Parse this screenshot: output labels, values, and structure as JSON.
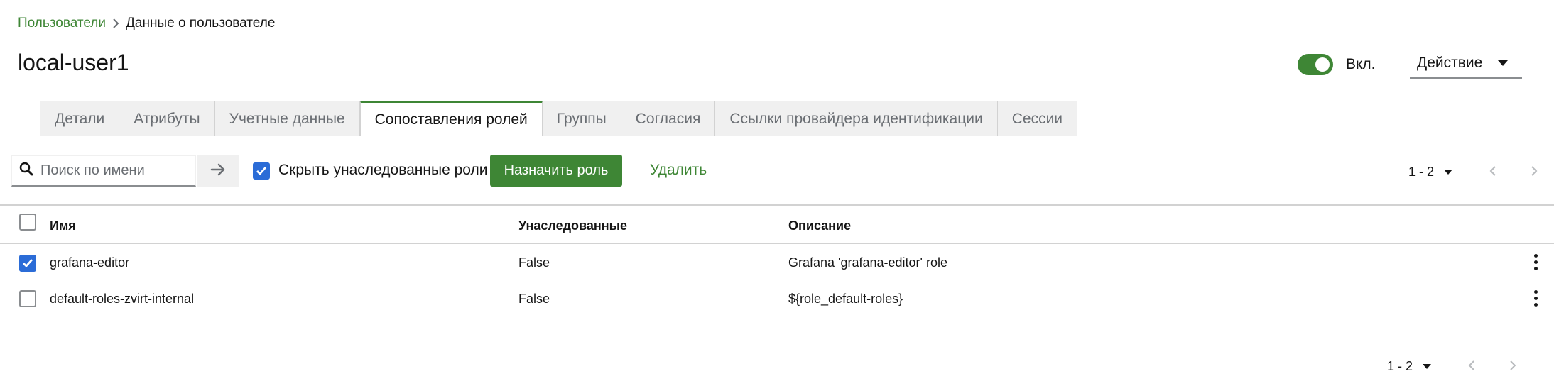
{
  "breadcrumb": {
    "parent": "Пользователи",
    "current": "Данные о пользователе"
  },
  "page_title": "local-user1",
  "enabled_toggle": {
    "label": "Вкл.",
    "on": true
  },
  "action_dropdown": {
    "label": "Действие"
  },
  "tabs": [
    {
      "label": "Детали",
      "active": false
    },
    {
      "label": "Атрибуты",
      "active": false
    },
    {
      "label": "Учетные данные",
      "active": false
    },
    {
      "label": "Сопоставления ролей",
      "active": true
    },
    {
      "label": "Группы",
      "active": false
    },
    {
      "label": "Согласия",
      "active": false
    },
    {
      "label": "Ссылки провайдера идентификации",
      "active": false
    },
    {
      "label": "Сессии",
      "active": false
    }
  ],
  "toolbar": {
    "search_placeholder": "Поиск по имени",
    "hide_inherited_label": "Скрыть унаследованные роли",
    "hide_inherited_checked": true,
    "assign_label": "Назначить роль",
    "delete_label": "Удалить",
    "pagination": "1 - 2"
  },
  "table": {
    "columns": [
      "Имя",
      "Унаследованные",
      "Описание"
    ],
    "rows": [
      {
        "name": "grafana-editor",
        "inherited": "False",
        "description": "Grafana 'grafana-editor' role",
        "checked": true
      },
      {
        "name": "default-roles-zvirt-internal",
        "inherited": "False",
        "description": "${role_default-roles}",
        "checked": false
      }
    ]
  },
  "footer": {
    "pagination": "1 - 2"
  },
  "colors": {
    "accent": "#3e8635",
    "checkbox": "#2b6cd7"
  }
}
